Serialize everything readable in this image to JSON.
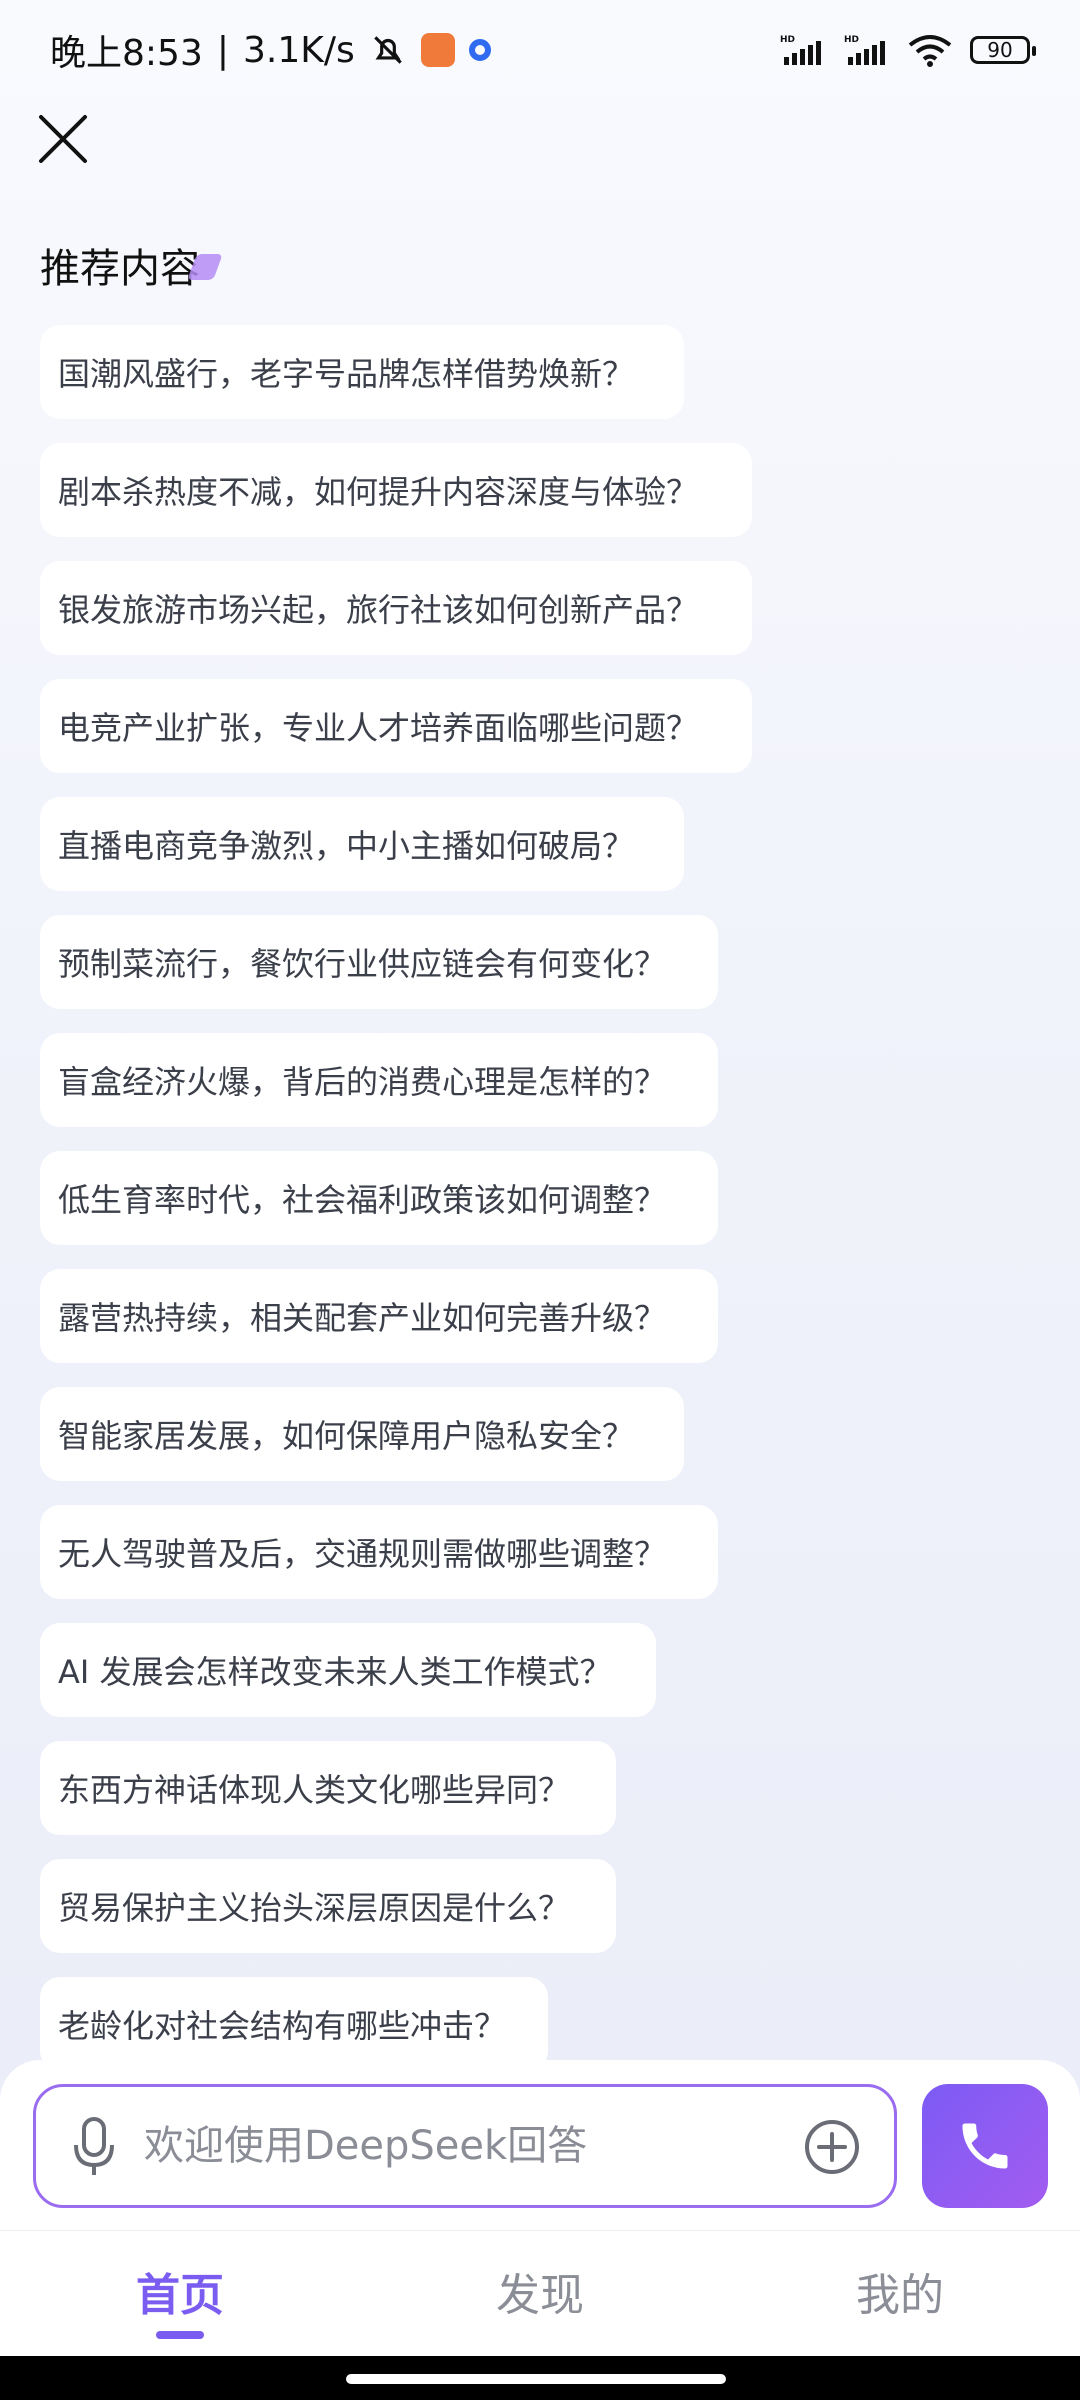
{
  "status_bar": {
    "time": "晚上8:53",
    "net_speed": "3.1K/s",
    "battery": "90",
    "network_label_1": "HD",
    "network_label_2": "HD"
  },
  "header": {
    "section_title": "推荐内容"
  },
  "suggestions": [
    "国潮风盛行，老字号品牌怎样借势焕新？",
    "剧本杀热度不减，如何提升内容深度与体验？",
    "银发旅游市场兴起，旅行社该如何创新产品？",
    "电竞产业扩张，专业人才培养面临哪些问题？",
    "直播电商竞争激烈，中小主播如何破局？",
    "预制菜流行，餐饮行业供应链会有何变化？",
    "盲盒经济火爆，背后的消费心理是怎样的？",
    "低生育率时代，社会福利政策该如何调整？",
    "露营热持续，相关配套产业如何完善升级？",
    "智能家居发展，如何保障用户隐私安全？",
    "无人驾驶普及后，交通规则需做哪些调整？",
    "AI 发展会怎样改变未来人类工作模式？",
    "东西方神话体现人类文化哪些异同？",
    "贸易保护主义抬头深层原因是什么？",
    "老龄化对社会结构有哪些冲击？"
  ],
  "input": {
    "placeholder": "欢迎使用DeepSeek回答"
  },
  "nav": {
    "home": "首页",
    "discover": "发现",
    "mine": "我的"
  },
  "colors": {
    "accent": "#7b5cf0",
    "input_border": "#9a6cf0"
  },
  "icons": [
    "close-icon",
    "mic-icon",
    "plus-circle-icon",
    "phone-icon",
    "wifi-icon",
    "signal-icon",
    "mute-bell-icon",
    "battery-icon"
  ]
}
